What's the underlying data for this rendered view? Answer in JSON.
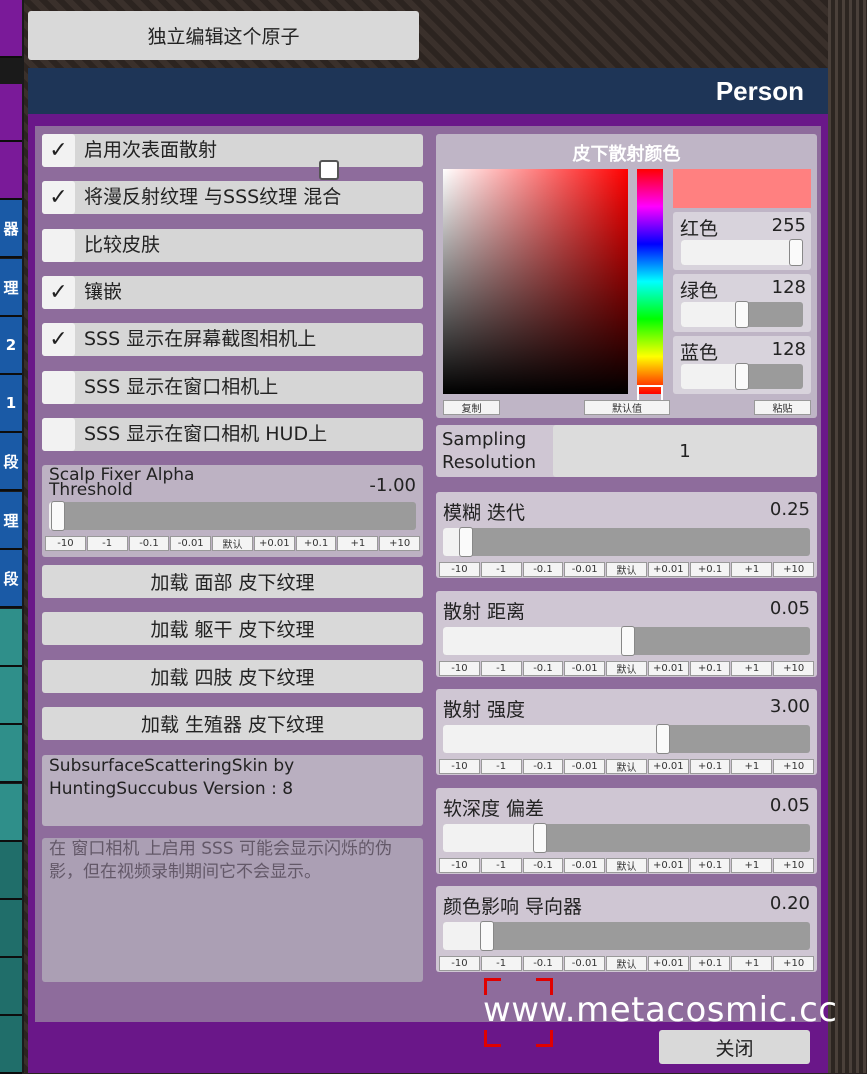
{
  "top_button": "独立编辑这个原子",
  "window_title": "Person",
  "left_tabs": [
    {
      "label": "",
      "color": "#7a1a99"
    },
    {
      "label": "",
      "color": "#7a1a99"
    },
    {
      "label": "",
      "color": "#7a1a99"
    },
    {
      "label": "器",
      "color": "#1a5aa6"
    },
    {
      "label": "理",
      "color": "#1a5aa6"
    },
    {
      "label": "2",
      "color": "#1a5aa6"
    },
    {
      "label": "1",
      "color": "#1a5aa6"
    },
    {
      "label": "段",
      "color": "#1a5aa6"
    },
    {
      "label": "理",
      "color": "#1a5aa6"
    },
    {
      "label": "段",
      "color": "#1a5aa6"
    },
    {
      "label": "",
      "color": "#2f8f8a"
    },
    {
      "label": "",
      "color": "#2f8f8a"
    },
    {
      "label": "",
      "color": "#2f8f8a"
    },
    {
      "label": "",
      "color": "#2f8f8a"
    },
    {
      "label": "",
      "color": "#206e6a"
    },
    {
      "label": "",
      "color": "#206e6a"
    },
    {
      "label": "",
      "color": "#206e6a"
    },
    {
      "label": "",
      "color": "#206e6a"
    }
  ],
  "checkboxes": [
    {
      "label": "启用次表面散射",
      "checked": true
    },
    {
      "label": "将漫反射纹理 与SSS纹理 混合",
      "checked": true
    },
    {
      "label": "比较皮肤",
      "checked": false
    },
    {
      "label": "镶嵌",
      "checked": true
    },
    {
      "label": "SSS 显示在屏幕截图相机上",
      "checked": true
    },
    {
      "label": "SSS 显示在窗口相机上",
      "checked": false
    },
    {
      "label": "SSS 显示在窗口相机 HUD上",
      "checked": false
    }
  ],
  "check_mark": "✓",
  "steps": [
    "-10",
    "-1",
    "-0.1",
    "-0.01",
    "默认",
    "+0.01",
    "+0.1",
    "+1",
    "+10"
  ],
  "scalp": {
    "label": "Scalp Fixer Alpha Threshold",
    "value": "-1.00",
    "fraction": 0.0
  },
  "load_buttons": [
    "加载 面部 皮下纹理",
    "加载 躯干 皮下纹理",
    "加载 四肢 皮下纹理",
    "加载 生殖器 皮下纹理"
  ],
  "version_text": "SubsurfaceScatteringSkin by HuntingSuccubus Version : 8",
  "info_text": "在 窗口相机 上启用 SSS 可能会显示闪烁的伪影，但在视频录制期间它不会显示。",
  "color_picker": {
    "title": "皮下散射颜色",
    "swatch": "#ff8080",
    "red": {
      "label": "红色",
      "value": "255",
      "fraction": 1.0
    },
    "green": {
      "label": "绿色",
      "value": "128",
      "fraction": 0.502
    },
    "blue": {
      "label": "蓝色",
      "value": "128",
      "fraction": 0.502
    },
    "copy": "复制",
    "default": "默认值",
    "paste": "粘贴"
  },
  "sampling": {
    "label": "Sampling Resolution",
    "value": "1"
  },
  "sliders": [
    {
      "label": "模糊 迭代",
      "value": "0.25",
      "fraction": 0.04
    },
    {
      "label": "散射 距离",
      "value": "0.05",
      "fraction": 0.5
    },
    {
      "label": "散射 强度",
      "value": "3.00",
      "fraction": 0.6
    },
    {
      "label": "软深度 偏差",
      "value": "0.05",
      "fraction": 0.25
    },
    {
      "label": "颜色影响 导向器",
      "value": "0.20",
      "fraction": 0.1
    }
  ],
  "close_button": "关闭",
  "watermark": "www.metacosmic.cc"
}
